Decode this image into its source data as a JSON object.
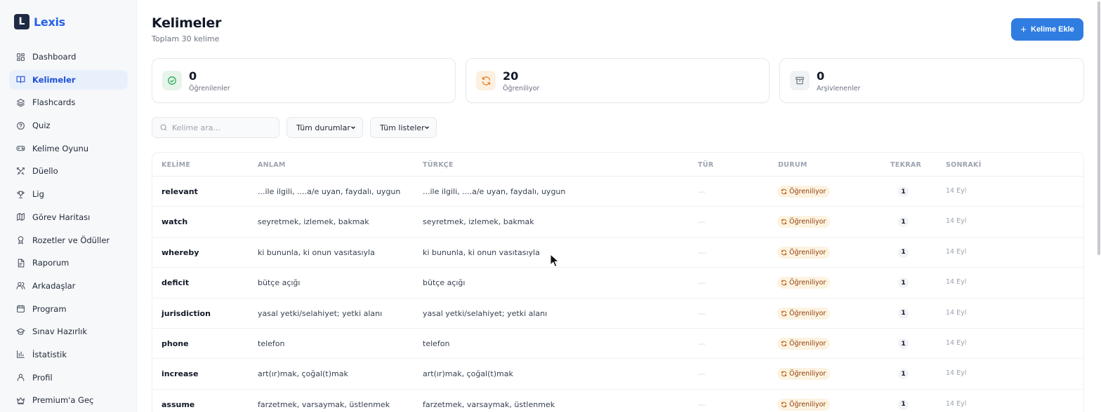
{
  "brand": {
    "logo_letter": "L",
    "name": "Lexis"
  },
  "sidebar": {
    "items": [
      {
        "label": "Dashboard",
        "icon": "grid-icon",
        "active": false
      },
      {
        "label": "Kelimeler",
        "icon": "book-open-icon",
        "active": true
      },
      {
        "label": "Flashcards",
        "icon": "layers-icon",
        "active": false
      },
      {
        "label": "Quiz",
        "icon": "help-circle-icon",
        "active": false
      },
      {
        "label": "Kelime Oyunu",
        "icon": "gamepad-icon",
        "active": false
      },
      {
        "label": "Düello",
        "icon": "swords-icon",
        "active": false
      },
      {
        "label": "Lig",
        "icon": "trophy-icon",
        "active": false
      },
      {
        "label": "Görev Haritası",
        "icon": "map-icon",
        "active": false
      },
      {
        "label": "Rozetler ve Ödüller",
        "icon": "award-icon",
        "active": false
      },
      {
        "label": "Raporum",
        "icon": "file-icon",
        "active": false
      },
      {
        "label": "Arkadaşlar",
        "icon": "users-icon",
        "active": false
      },
      {
        "label": "Program",
        "icon": "calendar-icon",
        "active": false
      },
      {
        "label": "Sınav Hazırlık",
        "icon": "graduation-cap-icon",
        "active": false
      },
      {
        "label": "İstatistik",
        "icon": "bar-chart-icon",
        "active": false
      },
      {
        "label": "Profil",
        "icon": "user-icon",
        "active": false
      },
      {
        "label": "Premium'a Geç",
        "icon": "crown-icon",
        "active": false
      }
    ]
  },
  "header": {
    "title": "Kelimeler",
    "subtitle": "Toplam 30 kelime",
    "add_button": "Kelime Ekle"
  },
  "stats": [
    {
      "value": "0",
      "label": "Öğrenilenler",
      "icon": "check-circle-icon",
      "color": "#16a34a",
      "bg": "#e6f4ea"
    },
    {
      "value": "20",
      "label": "Öğreniliyor",
      "icon": "refresh-icon",
      "color": "#ea7a1a",
      "bg": "#fdf0e0"
    },
    {
      "value": "0",
      "label": "Arşivlenenler",
      "icon": "archive-icon",
      "color": "#6b7280",
      "bg": "#f1f2f5"
    }
  ],
  "filters": {
    "search_placeholder": "Kelime ara...",
    "status_select": "Tüm durumlar",
    "list_select": "Tüm listeler"
  },
  "table": {
    "headers": {
      "word": "KELİME",
      "meaning": "ANLAM",
      "turkish": "TÜRKÇE",
      "type": "TÜR",
      "status": "DURUM",
      "repeat": "TEKRAR",
      "next": "SONRAKİ"
    },
    "rows": [
      {
        "word": "relevant",
        "meaning": "...ile ilgili, ....a/e uyan, faydalı, uygun",
        "turkish": "...ile ilgili, ....a/e uyan, faydalı, uygun",
        "type": "—",
        "status": "Öğreniliyor",
        "repeat": "1",
        "next": "14 Eyl"
      },
      {
        "word": "watch",
        "meaning": "seyretmek, izlemek, bakmak",
        "turkish": "seyretmek, izlemek, bakmak",
        "type": "—",
        "status": "Öğreniliyor",
        "repeat": "1",
        "next": "14 Eyl"
      },
      {
        "word": "whereby",
        "meaning": "ki bununla, ki onun vasıtasıyla",
        "turkish": "ki bununla, ki onun vasıtasıyla",
        "type": "—",
        "status": "Öğreniliyor",
        "repeat": "1",
        "next": "14 Eyl"
      },
      {
        "word": "deficit",
        "meaning": "bütçe açığı",
        "turkish": "bütçe açığı",
        "type": "—",
        "status": "Öğreniliyor",
        "repeat": "1",
        "next": "14 Eyl"
      },
      {
        "word": "jurisdiction",
        "meaning": "yasal yetki/selahiyet; yetki alanı",
        "turkish": "yasal yetki/selahiyet; yetki alanı",
        "type": "—",
        "status": "Öğreniliyor",
        "repeat": "1",
        "next": "14 Eyl"
      },
      {
        "word": "phone",
        "meaning": "telefon",
        "turkish": "telefon",
        "type": "—",
        "status": "Öğreniliyor",
        "repeat": "1",
        "next": "14 Eyl"
      },
      {
        "word": "increase",
        "meaning": "art(ır)mak, çoğal(t)mak",
        "turkish": "art(ır)mak, çoğal(t)mak",
        "type": "—",
        "status": "Öğreniliyor",
        "repeat": "1",
        "next": "14 Eyl"
      },
      {
        "word": "assume",
        "meaning": "farzetmek, varsaymak, üstlenmek",
        "turkish": "farzetmek, varsaymak, üstlenmek",
        "type": "—",
        "status": "Öğreniliyor",
        "repeat": "1",
        "next": "14 Eyl"
      }
    ]
  }
}
